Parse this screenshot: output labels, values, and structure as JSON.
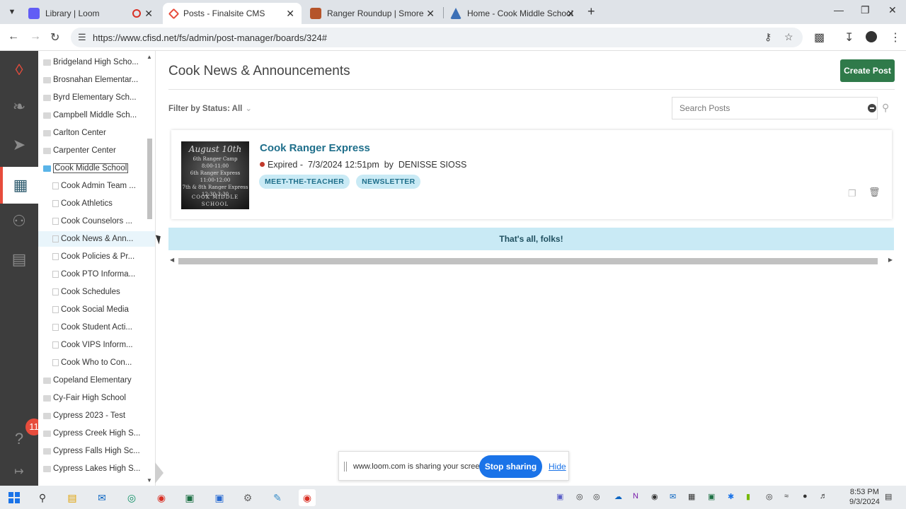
{
  "browser": {
    "tabs": [
      {
        "label": "Library | Loom",
        "icon": "loom-icon",
        "active": false,
        "recording": true
      },
      {
        "label": "Posts - Finalsite CMS",
        "icon": "finalsite-icon",
        "active": true
      },
      {
        "label": "Ranger Roundup | Smore News",
        "icon": "smore-icon",
        "active": false
      },
      {
        "label": "Home - Cook Middle School",
        "icon": "school-icon",
        "active": false
      }
    ],
    "url": "https://www.cfisd.net/fs/admin/post-manager/boards/324#"
  },
  "sidebar": {
    "badge_count": "11",
    "items": [
      {
        "label": "Bridgeland High Scho...",
        "level": 0,
        "type": "folder"
      },
      {
        "label": "Brosnahan Elementar...",
        "level": 0,
        "type": "folder"
      },
      {
        "label": "Byrd Elementary Sch...",
        "level": 0,
        "type": "folder"
      },
      {
        "label": "Campbell Middle Sch...",
        "level": 0,
        "type": "folder"
      },
      {
        "label": "Carlton Center",
        "level": 0,
        "type": "folder"
      },
      {
        "label": "Carpenter Center",
        "level": 0,
        "type": "folder"
      },
      {
        "label": "Cook Middle School",
        "level": 0,
        "type": "folder",
        "selected": true
      },
      {
        "label": "Cook Admin Team ...",
        "level": 1,
        "type": "board"
      },
      {
        "label": "Cook Athletics",
        "level": 1,
        "type": "board"
      },
      {
        "label": "Cook Counselors ...",
        "level": 1,
        "type": "board"
      },
      {
        "label": "Cook News & Ann...",
        "level": 1,
        "type": "board",
        "active": true
      },
      {
        "label": "Cook Policies & Pr...",
        "level": 1,
        "type": "board"
      },
      {
        "label": "Cook PTO Informa...",
        "level": 1,
        "type": "board"
      },
      {
        "label": "Cook Schedules",
        "level": 1,
        "type": "board"
      },
      {
        "label": "Cook Social Media",
        "level": 1,
        "type": "board"
      },
      {
        "label": "Cook Student Acti...",
        "level": 1,
        "type": "board"
      },
      {
        "label": "Cook VIPS Inform...",
        "level": 1,
        "type": "board"
      },
      {
        "label": "Cook Who to Con...",
        "level": 1,
        "type": "board"
      },
      {
        "label": "Copeland Elementary",
        "level": 0,
        "type": "folder"
      },
      {
        "label": "Cy-Fair High School",
        "level": 0,
        "type": "folder"
      },
      {
        "label": "Cypress 2023 - Test",
        "level": 0,
        "type": "folder"
      },
      {
        "label": "Cypress Creek High S...",
        "level": 0,
        "type": "folder"
      },
      {
        "label": "Cypress Falls High Sc...",
        "level": 0,
        "type": "folder"
      },
      {
        "label": "Cypress Lakes High S...",
        "level": 0,
        "type": "folder"
      }
    ]
  },
  "main": {
    "title": "Cook News & Announcements",
    "create_label": "Create Post",
    "filter_label": "Filter by Status: All",
    "search_placeholder": "Search Posts",
    "post": {
      "title": "Cook Ranger Express",
      "status": "Expired",
      "meta": " -  7/3/2024 12:51pm  by  DENISSE SIOSS",
      "tags": [
        "MEET-THE-TEACHER",
        "NEWSLETTER"
      ],
      "thumb_script": "August 10th",
      "thumb_lines": [
        "6th Ranger Camp",
        "8:00-11:00",
        "6th Ranger Express",
        "11:00-12:00",
        "7th & 8th Ranger Express",
        "12:30-3:30"
      ],
      "thumb_school": "COOK MIDDLE SCHOOL"
    },
    "end_message": "That's all, folks!"
  },
  "loom": {
    "message": "www.loom.com is sharing your screen.",
    "stop_label": "Stop sharing",
    "hide_label": "Hide"
  },
  "taskbar": {
    "time": "8:53 PM",
    "date": "9/3/2024"
  },
  "colors": {
    "accent_green": "#2f7a4a",
    "link_blue": "#1f6f8b",
    "tag_bg": "#c9eaf5",
    "rail_bg": "#3d3d3d",
    "status_expired": "#c0392b"
  }
}
